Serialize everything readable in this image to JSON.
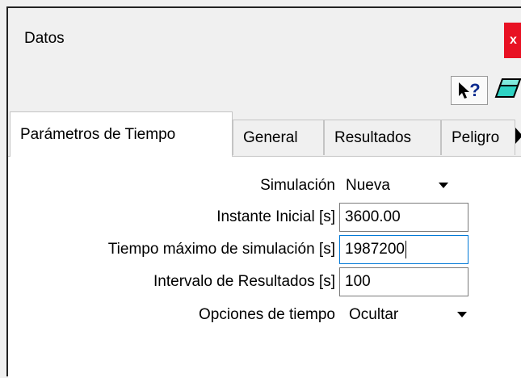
{
  "window": {
    "title": "Datos",
    "close_label": "x"
  },
  "toolbar": {
    "help_icon": "context-help-icon",
    "help_label": "?",
    "eraser_icon": "eraser-icon"
  },
  "tabs": [
    {
      "label": "Parámetros de Tiempo",
      "active": true
    },
    {
      "label": "General",
      "active": false
    },
    {
      "label": "Resultados",
      "active": false
    },
    {
      "label": "Peligro",
      "active": false
    }
  ],
  "form": {
    "simulacion": {
      "label": "Simulación",
      "value": "Nueva"
    },
    "instante_inicial": {
      "label": "Instante Inicial [s]",
      "value": "3600.00"
    },
    "tiempo_maximo": {
      "label": "Tiempo máximo de simulación [s]",
      "value": "1987200"
    },
    "intervalo": {
      "label": "Intervalo de Resultados [s]",
      "value": "100"
    },
    "opciones": {
      "label": "Opciones de tiempo",
      "value": "Ocultar"
    }
  },
  "colors": {
    "close_bg": "#e81123",
    "focus_border": "#0078d7",
    "panel_bg": "#ffffff",
    "window_bg": "#f0f0f0"
  }
}
